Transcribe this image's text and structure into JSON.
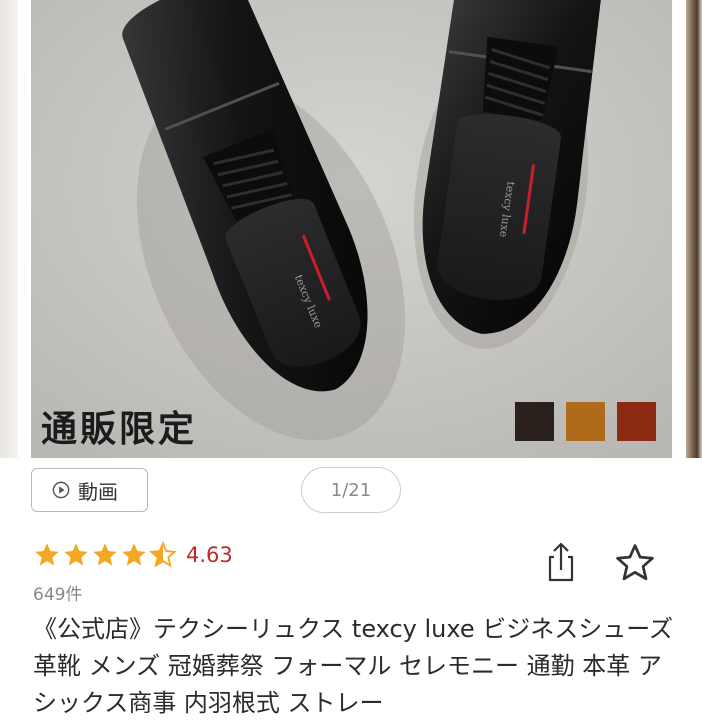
{
  "product_image": {
    "alt": "black leather straight-tip business shoes",
    "overlay_text": "通販限定",
    "insole_brand": "texcy luxe",
    "color_swatches": [
      {
        "name": "black",
        "color": "#2a201c"
      },
      {
        "name": "brown",
        "color": "#b06a1c"
      },
      {
        "name": "dark-red",
        "color": "#8a2a10"
      }
    ]
  },
  "controls": {
    "video_label": "動画",
    "video_icon": "play-circle-icon",
    "image_counter": "1/21"
  },
  "rating": {
    "stars": 4.5,
    "value": "4.63",
    "star_color": "#f5a623",
    "value_color": "#c0282d",
    "review_count": "649件"
  },
  "actions": {
    "share_icon": "share-icon",
    "favorite_icon": "star-outline-icon"
  },
  "product": {
    "title": "《公式店》テクシーリュクス texcy luxe ビジネスシューズ 革靴 メンズ 冠婚葬祭 フォーマル セレモニー 通勤 本革 アシックス商事 内羽根式 ストレー"
  }
}
